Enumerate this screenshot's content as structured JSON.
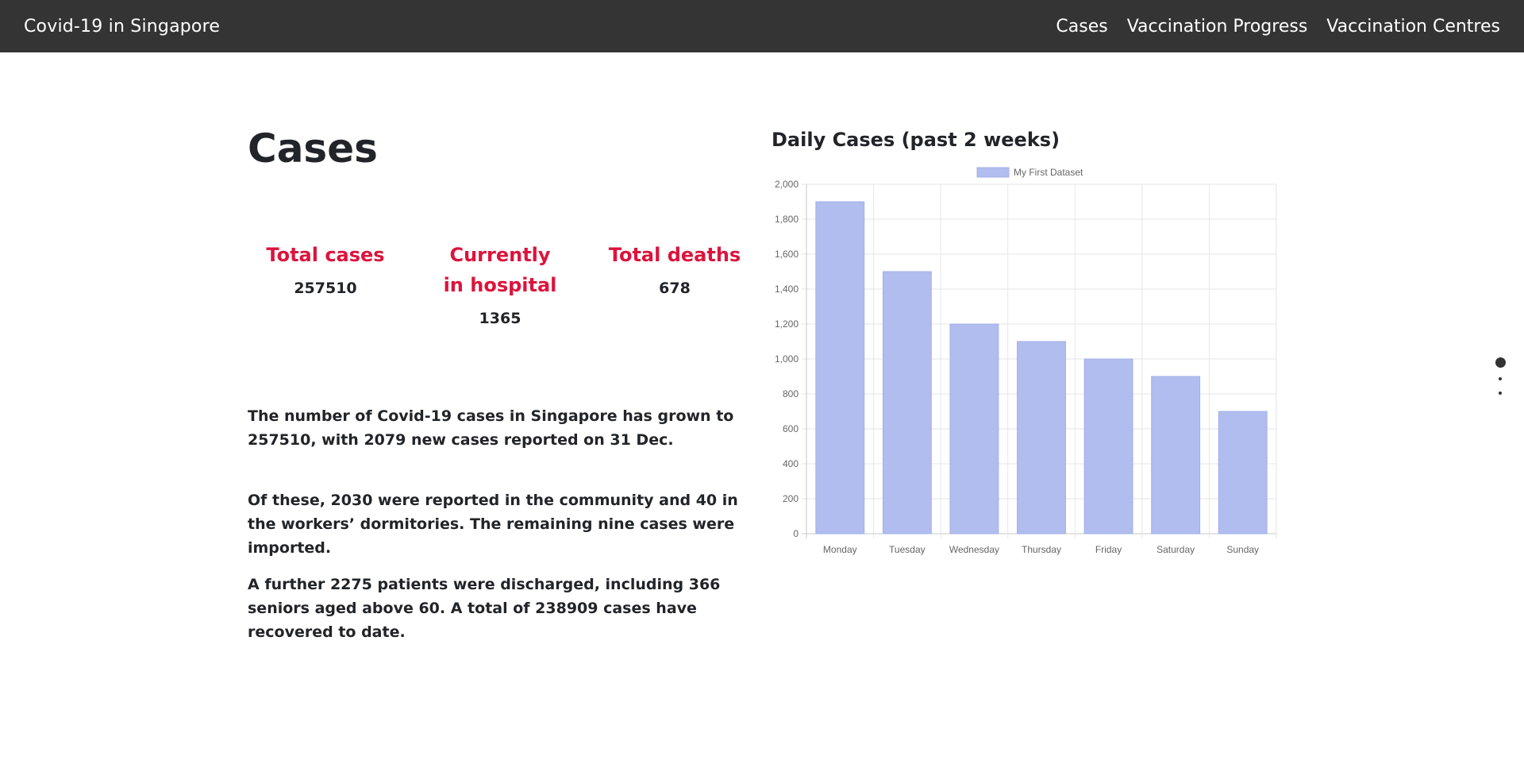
{
  "navbar": {
    "brand": "Covid-19 in Singapore",
    "links": [
      "Cases",
      "Vaccination Progress",
      "Vaccination Centres"
    ]
  },
  "main": {
    "title": "Cases",
    "stats": [
      {
        "label": "Total cases",
        "value": "257510"
      },
      {
        "label": "Currently in hospital",
        "value": "1365"
      },
      {
        "label": "Total deaths",
        "value": "678"
      }
    ],
    "paragraphs": [
      "The number of Covid-19 cases in Singapore has grown to 257510, with 2079 new cases reported on 31 Dec.",
      "Of these, 2030 were reported in the community and 40 in the workers’ dormitories. The remaining nine cases were imported.",
      "A further 2275 patients were discharged, including 366 seniors aged above 60. A total of 238909 cases have recovered to date."
    ]
  },
  "chart_section": {
    "title": "Daily Cases (past 2 weeks)"
  },
  "chart_data": {
    "type": "bar",
    "categories": [
      "Monday",
      "Tuesday",
      "Wednesday",
      "Thursday",
      "Friday",
      "Saturday",
      "Sunday"
    ],
    "series": [
      {
        "name": "My First Dataset",
        "values": [
          1900,
          1500,
          1200,
          1100,
          1000,
          900,
          700
        ]
      }
    ],
    "ylim": [
      0,
      2000
    ],
    "yticks": [
      "0",
      "200",
      "400",
      "600",
      "800",
      "1,000",
      "1,200",
      "1,400",
      "1,600",
      "1,800",
      "2,000"
    ],
    "grid": true,
    "legend": "top-center",
    "bar_color": "#b0bdee",
    "bar_border_color": "#a3b1ea"
  },
  "side_nav": {
    "dots": [
      "section-1",
      "section-2",
      "section-3"
    ]
  },
  "colors": {
    "navbar": "#343434",
    "accent": "#dc143c",
    "text": "#212529"
  }
}
